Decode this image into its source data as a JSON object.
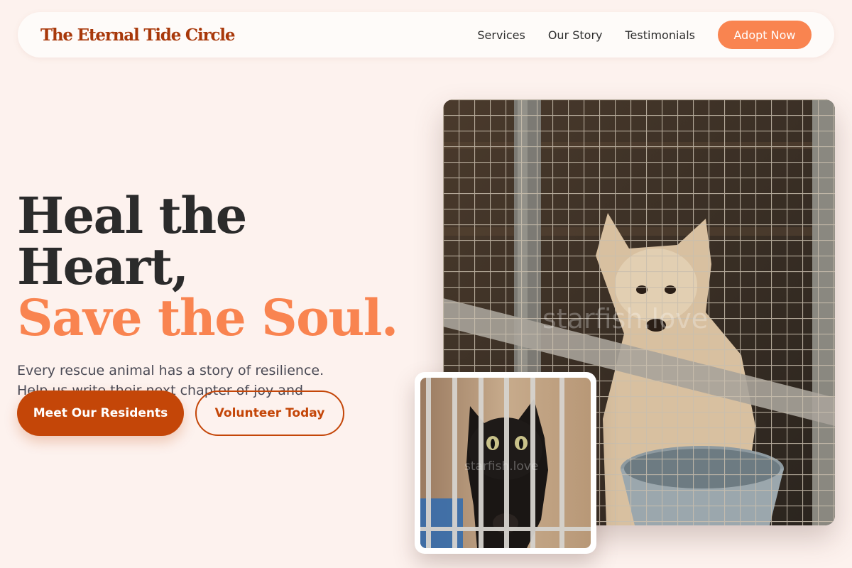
{
  "nav": {
    "brand": "The Eternal Tide Circle",
    "links": [
      "Services",
      "Our Story",
      "Testimonials"
    ],
    "cta_label": "Adopt Now"
  },
  "hero": {
    "title_line1": "Heal the Heart,",
    "title_line2": "Save the Soul.",
    "description": "Every rescue animal has a story of resilience. Help us write their next chapter of joy and companionship.",
    "primary_button": "Meet Our Residents",
    "secondary_button": "Volunteer Today"
  },
  "images": {
    "main": {
      "subject": "dog-behind-cage-photo",
      "watermark": "starfish.love"
    },
    "inset": {
      "subject": "black-kitten-behind-bars-photo",
      "watermark": "starfish.love"
    }
  },
  "colors": {
    "background": "#fdf2ee",
    "brand": "#a8380a",
    "accent": "#f98450",
    "primary_button": "#c44608",
    "text_dark": "#2b2b2b",
    "text_muted": "#4a4a55"
  }
}
